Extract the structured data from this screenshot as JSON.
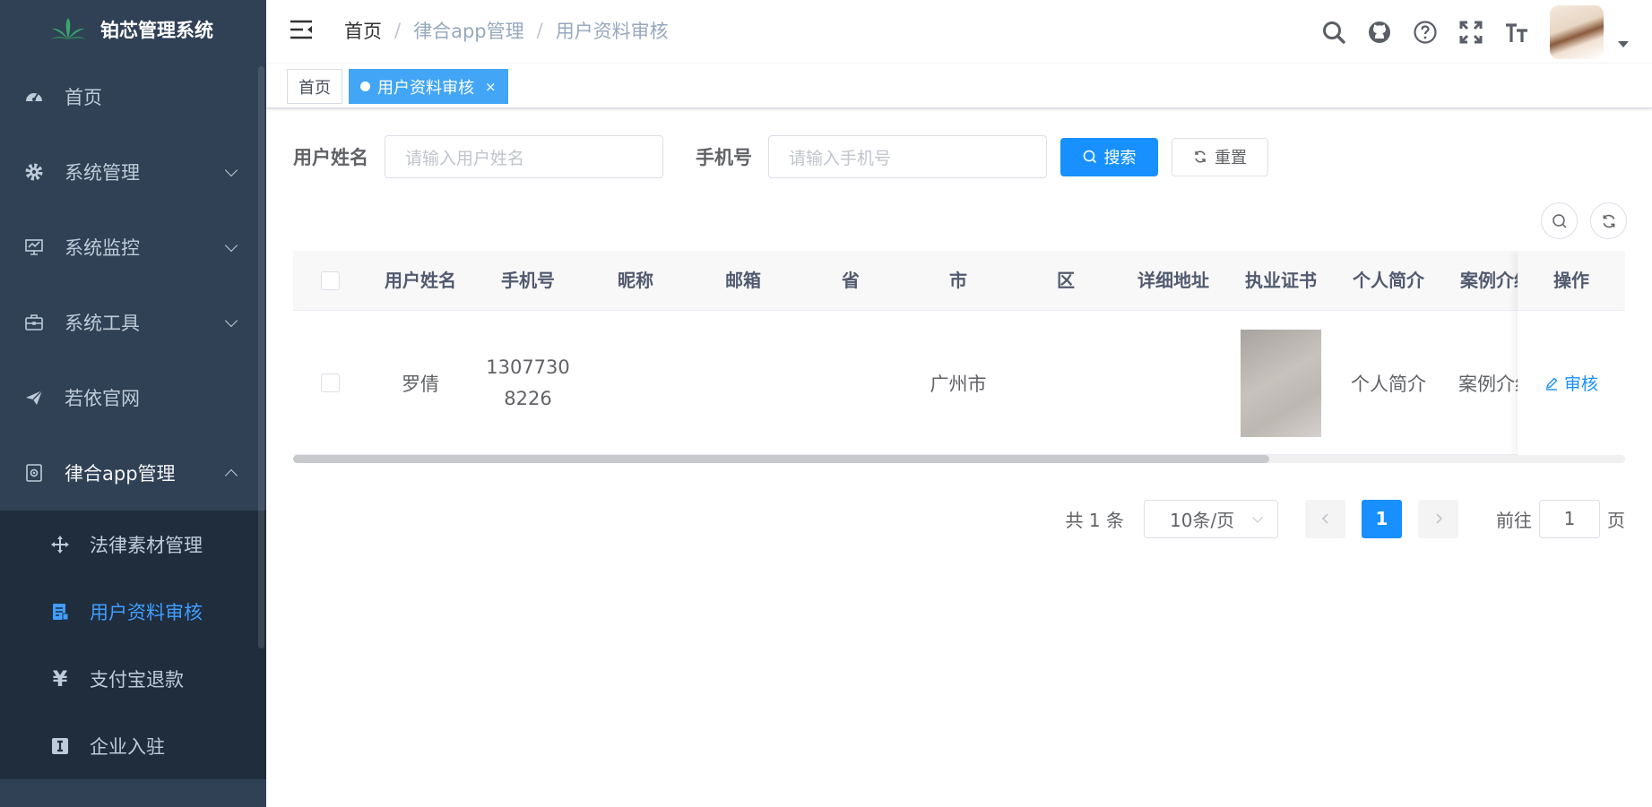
{
  "sidebar": {
    "title": "铂芯管理系统",
    "items": [
      {
        "label": "首页"
      },
      {
        "label": "系统管理"
      },
      {
        "label": "系统监控"
      },
      {
        "label": "系统工具"
      },
      {
        "label": "若依官网"
      },
      {
        "label": "律合app管理"
      }
    ],
    "submenu": [
      {
        "label": "法律素材管理"
      },
      {
        "label": "用户资料审核"
      },
      {
        "label": "支付宝退款"
      },
      {
        "label": "企业入驻"
      }
    ]
  },
  "header": {
    "breadcrumb": [
      "首页",
      "律合app管理",
      "用户资料审核"
    ],
    "breadcrumb_sep": "/"
  },
  "tags": {
    "home": "首页",
    "active": "用户资料审核",
    "close": "×"
  },
  "search": {
    "name_label": "用户姓名",
    "name_placeholder": "请输入用户姓名",
    "phone_label": "手机号",
    "phone_placeholder": "请输入手机号",
    "search_btn": "搜索",
    "reset_btn": "重置"
  },
  "table": {
    "columns": [
      "用户姓名",
      "手机号",
      "昵称",
      "邮箱",
      "省",
      "市",
      "区",
      "详细地址",
      "执业证书",
      "个人简介",
      "案例介绍",
      "操作"
    ],
    "rows": [
      {
        "name": "罗倩",
        "phone_line1": "1307730",
        "phone_line2": "8226",
        "nickname": "",
        "email": "",
        "province": "",
        "city": "广州市",
        "district": "",
        "address": "",
        "bio": "个人简介",
        "cases": "案例介绍",
        "action": "审核"
      }
    ]
  },
  "pagination": {
    "total": "共 1 条",
    "page_size": "10条/页",
    "current": "1",
    "goto_label": "前往",
    "goto_value": "1",
    "page_suffix": "页"
  },
  "colors": {
    "sidebar_bg": "#304156",
    "submenu_bg": "#1f2d3d",
    "accent": "#1890ff",
    "tag_active": "#42a5f5"
  }
}
